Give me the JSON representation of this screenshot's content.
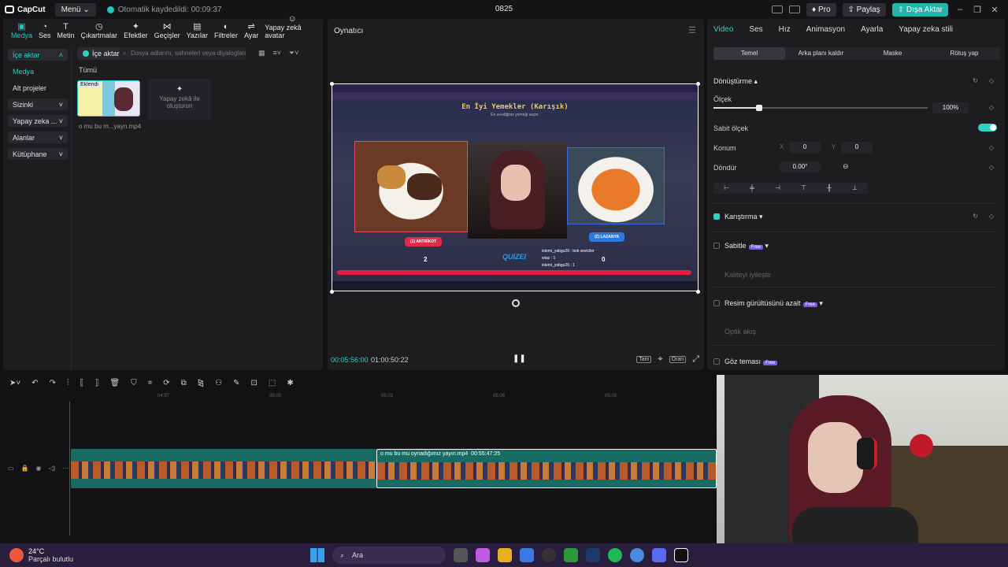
{
  "titlebar": {
    "app_name": "CapCut",
    "menu_label": "Menü",
    "autosave_text": "Otomatik kaydedildi: 00:09:37",
    "project_title": "0825",
    "pro_label": "Pro",
    "share_label": "Paylaş",
    "export_label": "Dışa Aktar"
  },
  "tools": [
    {
      "label": "Medya",
      "icon": "media-icon"
    },
    {
      "label": "Ses",
      "icon": "audio-icon"
    },
    {
      "label": "Metin",
      "icon": "text-icon"
    },
    {
      "label": "Çıkartmalar",
      "icon": "sticker-icon"
    },
    {
      "label": "Efektler",
      "icon": "effects-icon"
    },
    {
      "label": "Geçişler",
      "icon": "transition-icon"
    },
    {
      "label": "Yazılar",
      "icon": "captions-icon"
    },
    {
      "label": "Filtreler",
      "icon": "filter-icon"
    },
    {
      "label": "Ayar",
      "icon": "adjust-icon"
    },
    {
      "label": "Yapay zekâ avatar",
      "icon": "avatar-icon"
    }
  ],
  "media_nav": {
    "import": "İçe aktar",
    "media": "Medya",
    "subprojects": "Alt projeler",
    "yours": "Sizinki",
    "ai": "Yapay zeka ...",
    "spaces": "Alanlar",
    "library": "Kütüphane"
  },
  "media_panel": {
    "import_button": "İçe aktar",
    "search_placeholder": "Dosya adlarını, sahneleri veya diyalogları ar...",
    "all_label": "Tümü",
    "thumb_badge": "Eklendi",
    "thumb_caption": "o mu bu m...yayn.mp4",
    "ai_create": "Yapay zekâ ile oluşturun"
  },
  "player": {
    "title": "Oynatıcı",
    "current_time": "00:05:56:00",
    "total_time": "01:00:50:22",
    "ratio_label": "Oran",
    "full_label": "Tam",
    "video": {
      "title": "En İyi Yemekler (Karışık)",
      "subtitle": "En sevdiğiniz yemeği seçin.",
      "answer1": "(1) ANTRİKOT",
      "answer2": "(2) LAZANYA",
      "score1": "2",
      "score2": "0",
      "logo": "QUIZEI",
      "chat1": "istemi_yabgu26 : bok seviciler",
      "chat2": "wtaz : 1",
      "chat3": "istemi_yabgu26 : 1"
    }
  },
  "props": {
    "tabs": [
      "Video",
      "Ses",
      "Hız",
      "Animasyon",
      "Ayarla",
      "Yapay zeka stili"
    ],
    "subtabs": [
      "Temel",
      "Arka planı kaldır",
      "Maske",
      "Rötuş yap"
    ],
    "transform": "Dönüştürme",
    "scale_label": "Ölçek",
    "scale_value": "100%",
    "uniform_scale": "Sabit ölçek",
    "position_label": "Konum",
    "pos_x_label": "X",
    "pos_x": "0",
    "pos_y_label": "Y",
    "pos_y": "0",
    "rotate_label": "Döndür",
    "rotate_value": "0.00°",
    "blend": "Karıştırma",
    "stabilize": "Sabitle",
    "free_badge": "Free",
    "quality": "Kaliteyi iyileştir",
    "denoise": "Resim gürültüsünü azalt",
    "optical_flow": "Optik akış",
    "eye_contact": "Göz teması"
  },
  "timeline": {
    "ticks": [
      "04:57",
      "05:00",
      "05:03",
      "05:06",
      "05:09"
    ],
    "clip_label": "o mu bu mu oynadığımız yayın.mp4",
    "clip_duration": "00:55:47:25"
  },
  "taskbar": {
    "temperature": "24°C",
    "weather": "Parçalı bulutlu",
    "search": "Ara"
  }
}
